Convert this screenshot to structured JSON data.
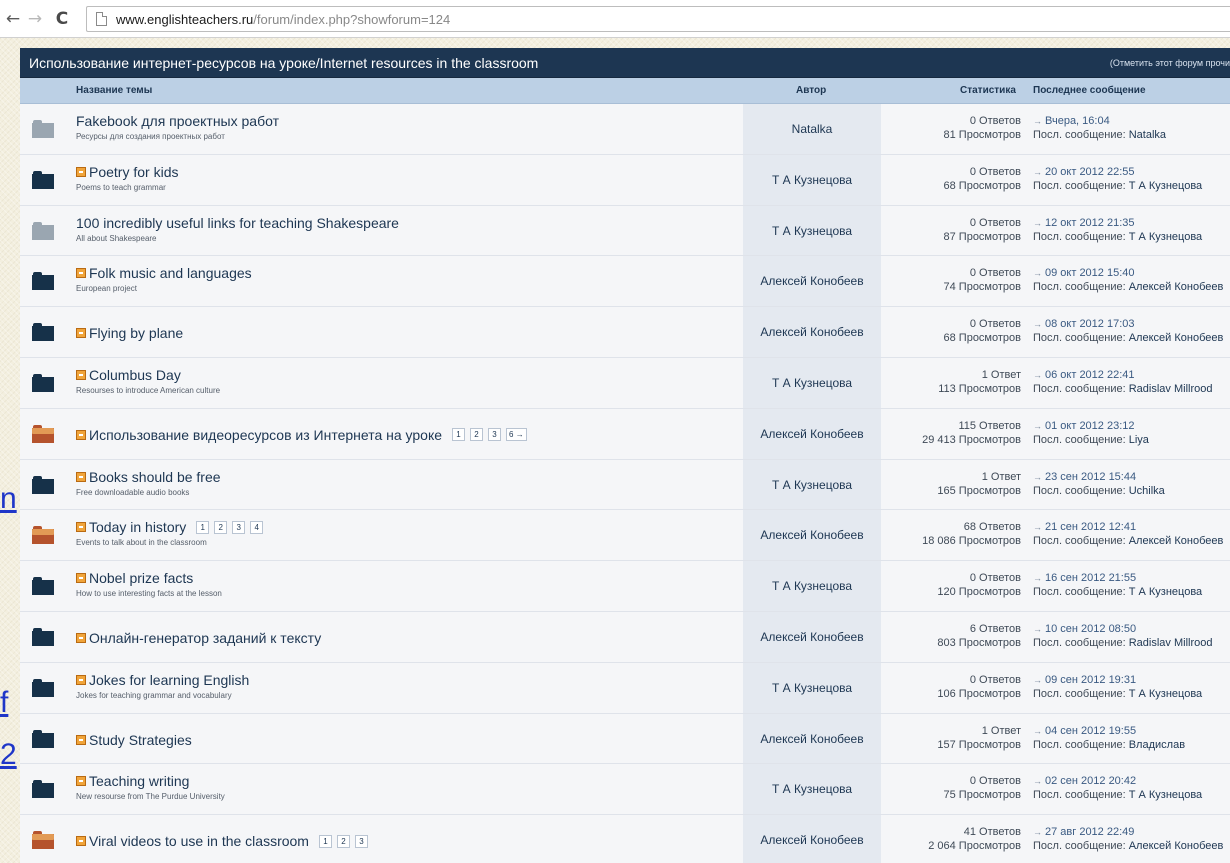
{
  "browser": {
    "back_icon": "←",
    "forward_icon": "→",
    "reload_icon": "C",
    "url_host": "www.englishteachers.ru",
    "url_path": "/forum/index.php?showforum=124"
  },
  "side_fragments": [
    "n",
    "f",
    "2"
  ],
  "forum": {
    "title": "Использование интернет-ресурсов на уроке/Internet resources in the classroom",
    "mark_read": "(Отметить этот форум прочи",
    "columns": {
      "topic": "Название темы",
      "author": "Автор",
      "stats": "Статистика",
      "last": "Последнее сообщение"
    },
    "last_prefix": "Посл. сообщение:",
    "topics": [
      {
        "icon": "grey",
        "new": false,
        "title": "Fakebook для проектных работ",
        "desc": "Ресурсы для создания проектных работ",
        "pages": [],
        "author": "Natalka",
        "replies": "0 Ответов",
        "views": "81 Просмотров",
        "last_date": "Вчера, 16:04",
        "last_user": "Natalka"
      },
      {
        "icon": "dark",
        "new": true,
        "title": "Poetry for kids",
        "desc": "Poems to teach grammar",
        "pages": [],
        "author": "Т А Кузнецова",
        "replies": "0 Ответов",
        "views": "68 Просмотров",
        "last_date": "20 окт 2012 22:55",
        "last_user": "Т А Кузнецова"
      },
      {
        "icon": "grey",
        "new": false,
        "title": "100 incredibly useful links for teaching Shakespeare",
        "desc": "All about Shakespeare",
        "pages": [],
        "author": "Т А Кузнецова",
        "replies": "0 Ответов",
        "views": "87 Просмотров",
        "last_date": "12 окт 2012 21:35",
        "last_user": "Т А Кузнецова"
      },
      {
        "icon": "dark",
        "new": true,
        "title": "Folk music and languages",
        "desc": "European project",
        "pages": [],
        "author": "Алексей Конобеев",
        "replies": "0 Ответов",
        "views": "74 Просмотров",
        "last_date": "09 окт 2012 15:40",
        "last_user": "Алексей Конобеев"
      },
      {
        "icon": "dark",
        "new": true,
        "title": "Flying by plane",
        "desc": "",
        "pages": [],
        "author": "Алексей Конобеев",
        "replies": "0 Ответов",
        "views": "68 Просмотров",
        "last_date": "08 окт 2012 17:03",
        "last_user": "Алексей Конобеев"
      },
      {
        "icon": "dark",
        "new": true,
        "title": "Columbus Day",
        "desc": "Resourses to introduce American culture",
        "pages": [],
        "author": "Т А Кузнецова",
        "replies": "1 Ответ",
        "views": "113 Просмотров",
        "last_date": "06 окт 2012 22:41",
        "last_user": "Radislav Millrood"
      },
      {
        "icon": "hot",
        "new": true,
        "title": "Использование видеоресурсов из Интернета на уроке",
        "desc": "",
        "pages": [
          "1",
          "2",
          "3",
          "6 →"
        ],
        "author": "Алексей Конобеев",
        "replies": "115 Ответов",
        "views": "29 413 Просмотров",
        "last_date": "01 окт 2012 23:12",
        "last_user": "Liya"
      },
      {
        "icon": "dark",
        "new": true,
        "title": "Books should be free",
        "desc": "Free downloadable audio books",
        "pages": [],
        "author": "Т А Кузнецова",
        "replies": "1 Ответ",
        "views": "165 Просмотров",
        "last_date": "23 сен 2012 15:44",
        "last_user": "Uchilka"
      },
      {
        "icon": "hot",
        "new": true,
        "title": "Today in history",
        "desc": "Events to talk about in the classroom",
        "pages": [
          "1",
          "2",
          "3",
          "4"
        ],
        "author": "Алексей Конобеев",
        "replies": "68 Ответов",
        "views": "18 086 Просмотров",
        "last_date": "21 сен 2012 12:41",
        "last_user": "Алексей Конобеев"
      },
      {
        "icon": "dark",
        "new": true,
        "title": "Nobel prize facts",
        "desc": "How to use interesting facts at the lesson",
        "pages": [],
        "author": "Т А Кузнецова",
        "replies": "0 Ответов",
        "views": "120 Просмотров",
        "last_date": "16 сен 2012 21:55",
        "last_user": "Т А Кузнецова"
      },
      {
        "icon": "dark",
        "new": true,
        "title": "Онлайн-генератор заданий к тексту",
        "desc": "",
        "pages": [],
        "author": "Алексей Конобеев",
        "replies": "6 Ответов",
        "views": "803 Просмотров",
        "last_date": "10 сен 2012 08:50",
        "last_user": "Radislav Millrood"
      },
      {
        "icon": "dark",
        "new": true,
        "title": "Jokes for learning English",
        "desc": "Jokes for teaching grammar and vocabulary",
        "pages": [],
        "author": "Т А Кузнецова",
        "replies": "0 Ответов",
        "views": "106 Просмотров",
        "last_date": "09 сен 2012 19:31",
        "last_user": "Т А Кузнецова"
      },
      {
        "icon": "dark",
        "new": true,
        "title": "Study Strategies",
        "desc": "",
        "pages": [],
        "author": "Алексей Конобеев",
        "replies": "1 Ответ",
        "views": "157 Просмотров",
        "last_date": "04 сен 2012 19:55",
        "last_user": "Владислав"
      },
      {
        "icon": "dark",
        "new": true,
        "title": "Teaching writing",
        "desc": "New resourse from The Purdue University",
        "pages": [],
        "author": "Т А Кузнецова",
        "replies": "0 Ответов",
        "views": "75 Просмотров",
        "last_date": "02 сен 2012 20:42",
        "last_user": "Т А Кузнецова"
      },
      {
        "icon": "hot",
        "new": true,
        "title": "Viral videos to use in the classroom",
        "desc": "",
        "pages": [
          "1",
          "2",
          "3"
        ],
        "author": "Алексей Конобеев",
        "replies": "41 Ответов",
        "views": "2 064 Просмотров",
        "last_date": "27 авг 2012 22:49",
        "last_user": "Алексей Конобеев"
      }
    ]
  }
}
